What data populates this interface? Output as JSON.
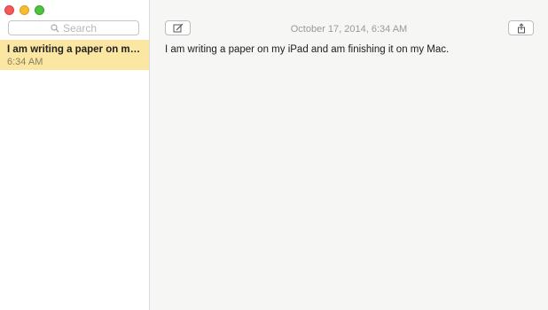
{
  "sidebar": {
    "search": {
      "placeholder": "Search"
    },
    "notes": [
      {
        "title": "I am writing a paper on my iPad and am finishing it on my Mac.",
        "time": "6:34 AM"
      }
    ]
  },
  "editor": {
    "date": "October 17, 2014, 6:34 AM",
    "body": "I am writing a paper on my iPad and am finishing it on my Mac."
  },
  "icons": {
    "compose": "compose-icon",
    "share": "share-icon",
    "search": "search-icon"
  },
  "colors": {
    "selected_note": "#fbe7a1",
    "editor_bg": "#f6f6f4"
  }
}
